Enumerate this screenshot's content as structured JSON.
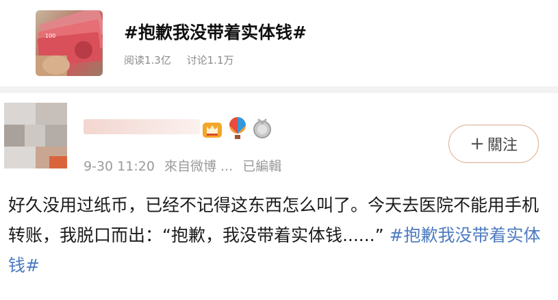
{
  "topic": {
    "title": "#抱歉我没带着实体钱#",
    "reads": "阅读1.3亿",
    "discussions": "讨论1.1万"
  },
  "post": {
    "timestamp": "9-30 11:20",
    "source": "來自微博 ...",
    "edited": "已編輯",
    "follow_plus": "+",
    "follow_label": "關注",
    "body_text": "好久没用过纸币，已经不记得这东西怎么叫了。今天去医院不能用手机转账，我脱口而出：“抱歉，我没带着实体钱......” ",
    "body_hashtag": "#抱歉我没带着实体钱#",
    "badge_icons": [
      "crown-icon",
      "hot-air-balloon-icon",
      "medal-icon"
    ]
  },
  "colors": {
    "hashtag": "#4d7bbf",
    "follow_border": "#d9a98a",
    "meta": "#9a9a9a"
  }
}
